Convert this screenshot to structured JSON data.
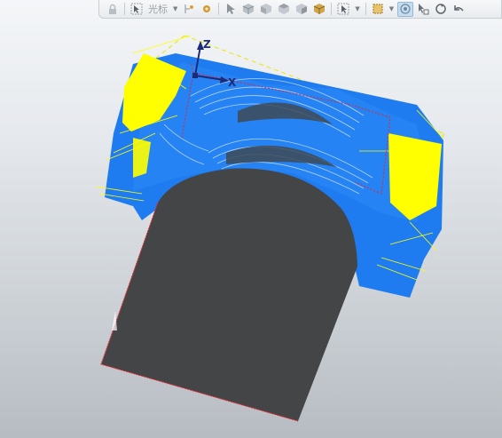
{
  "toolbar": {
    "selection_label": "光标",
    "icons": [
      "lock-icon",
      "select-cursor-icon",
      "gear-icon",
      "pointer-icon",
      "view-cube-icons",
      "layer-icon",
      "box-select-icon",
      "eye-icon",
      "transform-icon",
      "rotate-icon",
      "undo-icon"
    ]
  },
  "triad": {
    "z_label": "Z",
    "x_label": "X"
  },
  "colors": {
    "toolpath_blue": "#1f7cf0",
    "toolpath_yellow": "#ffff00",
    "stock_gray": "#444546",
    "triad_navy": "#1b2b78",
    "boundary_red": "#e8242c"
  }
}
